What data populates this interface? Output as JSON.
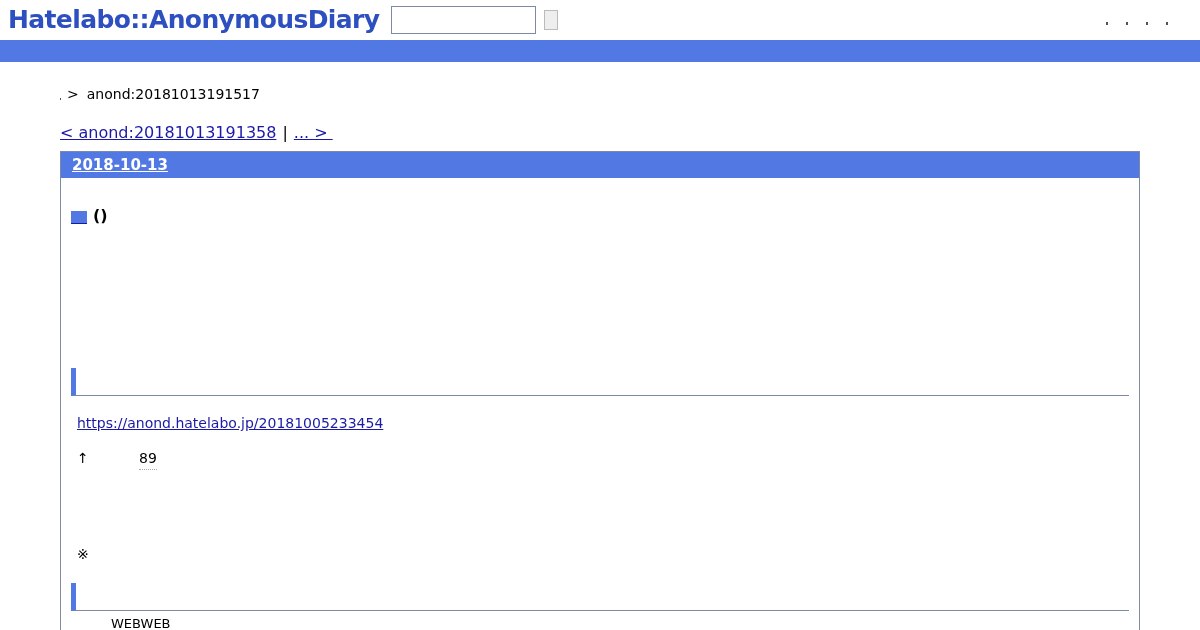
{
  "header": {
    "logo": "Hatelabo::AnonymousDiary"
  },
  "breadcrumb": {
    "separator": ">",
    "current": "anond:20181013191517"
  },
  "pager": {
    "prev": "< anond:20181013191358",
    "divider": "|",
    "next": "... > "
  },
  "day": {
    "date": "2018-10-13",
    "title": "()",
    "link": "https://anond.hatelabo.jp/20181005233454",
    "arrow": "↑",
    "count": "89",
    "note": "※",
    "tail": "WEBWEB"
  }
}
